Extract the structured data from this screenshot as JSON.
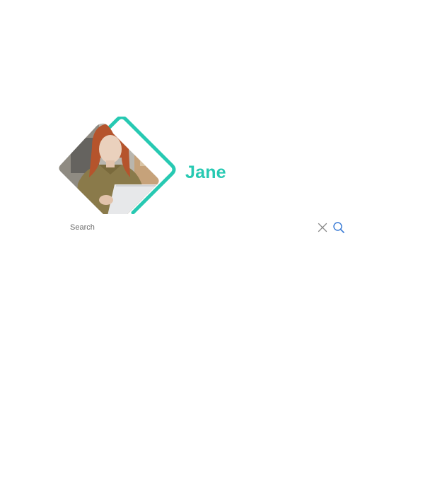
{
  "profile": {
    "name": "Jane",
    "accent_color": "#27c9b2",
    "avatar_alt": "photo-of-woman-with-laptop"
  },
  "search": {
    "placeholder": "Search",
    "value": "",
    "clear_icon": "close-icon",
    "search_icon": "search-icon",
    "clear_icon_color": "#8a8a8a",
    "search_icon_color": "#3a7bd5"
  }
}
